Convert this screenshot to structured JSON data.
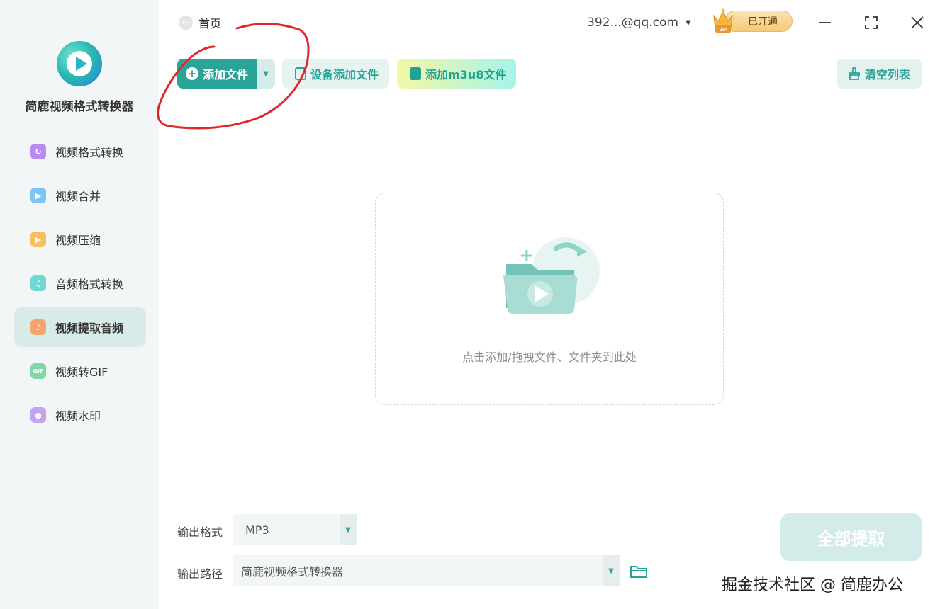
{
  "app": {
    "name": "简鹿视频格式转换器"
  },
  "sidebar": {
    "items": [
      {
        "label": "视频格式转换",
        "icon": "video-convert-icon",
        "color": "#b98af2"
      },
      {
        "label": "视频合并",
        "icon": "video-merge-icon",
        "color": "#7cc6f5"
      },
      {
        "label": "视频压缩",
        "icon": "video-compress-icon",
        "color": "#f6c15a"
      },
      {
        "label": "音频格式转换",
        "icon": "audio-convert-icon",
        "color": "#6fd8d2"
      },
      {
        "label": "视频提取音频",
        "icon": "extract-audio-icon",
        "color": "#f4a46e",
        "active": true
      },
      {
        "label": "视频转GIF",
        "icon": "gif-icon",
        "color": "#7ed8a8"
      },
      {
        "label": "视频水印",
        "icon": "watermark-icon",
        "color": "#c7a2f3"
      }
    ]
  },
  "topbar": {
    "home_label": "首页",
    "account": "392...@qq.com",
    "vip_label": "已开通",
    "vip_badge": "VIP"
  },
  "toolbar": {
    "add_file": "添加文件",
    "device_add": "设备添加文件",
    "m3u8_add": "添加m3u8文件",
    "clear_list": "清空列表"
  },
  "dropzone": {
    "text": "点击添加/拖拽文件、文件夹到此处"
  },
  "output": {
    "format_label": "输出格式",
    "format_value": "MP3",
    "path_label": "输出路径",
    "path_value": "简鹿视频格式转换器"
  },
  "actions": {
    "extract_all": "全部提取"
  },
  "watermark": "掘金技术社区 @ 简鹿办公",
  "colors": {
    "accent": "#2aa498",
    "sidebar_bg": "#f3f6f6",
    "active_bg": "#d9ebe8"
  }
}
